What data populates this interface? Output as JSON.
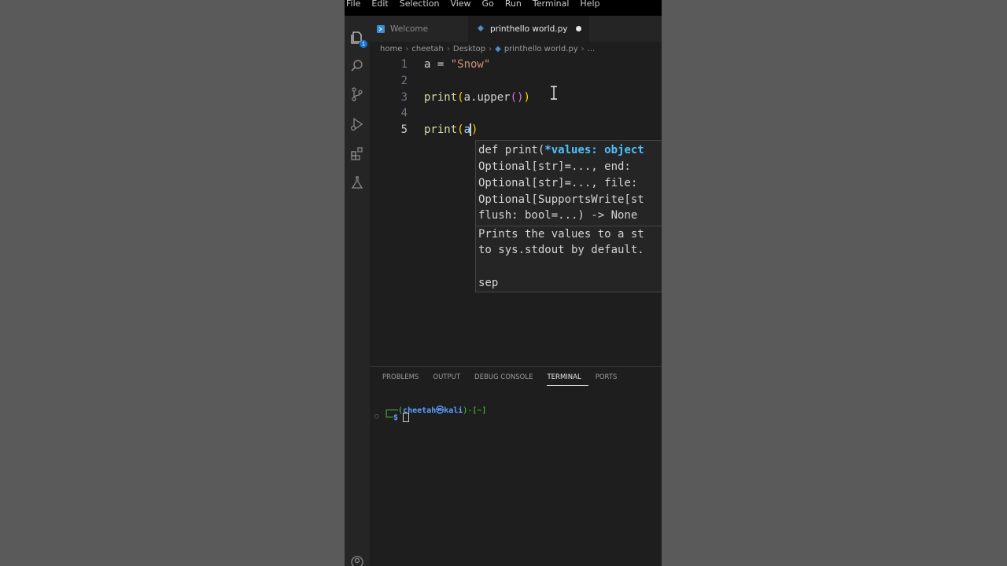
{
  "menubar": {
    "items": [
      "File",
      "Edit",
      "Selection",
      "View",
      "Go",
      "Run",
      "Terminal",
      "Help"
    ]
  },
  "activity": {
    "explorer_badge": "1",
    "icons": [
      "files-icon",
      "search-icon",
      "source-control-icon",
      "run-debug-icon",
      "extensions-icon",
      "testing-icon",
      "account-icon"
    ]
  },
  "tabs": [
    {
      "label": "Welcome",
      "active": false
    },
    {
      "label": "printhello world.py",
      "active": true,
      "modified": true
    }
  ],
  "breadcrumb": [
    "home",
    "cheetah",
    "Desktop",
    "printhello world.py",
    "..."
  ],
  "editor": {
    "lines": [
      {
        "num": "1",
        "tokens": [
          {
            "t": "a = ",
            "c": "plain"
          },
          {
            "t": "\"Snow\"",
            "c": "str"
          }
        ]
      },
      {
        "num": "2",
        "tokens": []
      },
      {
        "num": "3",
        "tokens": [
          {
            "t": "print",
            "c": "fn"
          },
          {
            "t": "(",
            "c": "par1"
          },
          {
            "t": "a.upper",
            "c": "plain"
          },
          {
            "t": "()",
            "c": "par2"
          },
          {
            "t": ")",
            "c": "par1"
          }
        ]
      },
      {
        "num": "4",
        "tokens": []
      },
      {
        "num": "5",
        "tokens": [
          {
            "t": "print",
            "c": "fn"
          },
          {
            "t": "(",
            "c": "par1"
          },
          {
            "t": "a",
            "c": "var"
          },
          {
            "t": ")",
            "c": "par1"
          }
        ]
      }
    ],
    "current_line": "5"
  },
  "hover": {
    "sig_prefix": "def print(",
    "sig_param": "*values: object",
    "sig_lines": [
      "Optional[str]=..., end:",
      "Optional[str]=..., file:",
      "Optional[SupportsWrite[st",
      "flush: bool=...) -> None"
    ],
    "doc_lines": [
      "Prints the values to a st",
      "to sys.stdout by default."
    ],
    "param_name": "sep"
  },
  "panel": {
    "tabs": [
      {
        "label": "PROBLEMS",
        "active": false
      },
      {
        "label": "OUTPUT",
        "active": false
      },
      {
        "label": "DEBUG CONSOLE",
        "active": false
      },
      {
        "label": "TERMINAL",
        "active": true
      },
      {
        "label": "PORTS",
        "active": false
      }
    ],
    "terminal": {
      "box_top": "┌──(",
      "user": "cheetah㉿kali",
      "cwd_part": ")-[~]",
      "box_bottom": "└─",
      "prompt": "$ "
    }
  },
  "colors": {
    "editor_bg": "#1e1e1e",
    "sidebar_bg": "#252526",
    "accent": "#1a75d2"
  }
}
